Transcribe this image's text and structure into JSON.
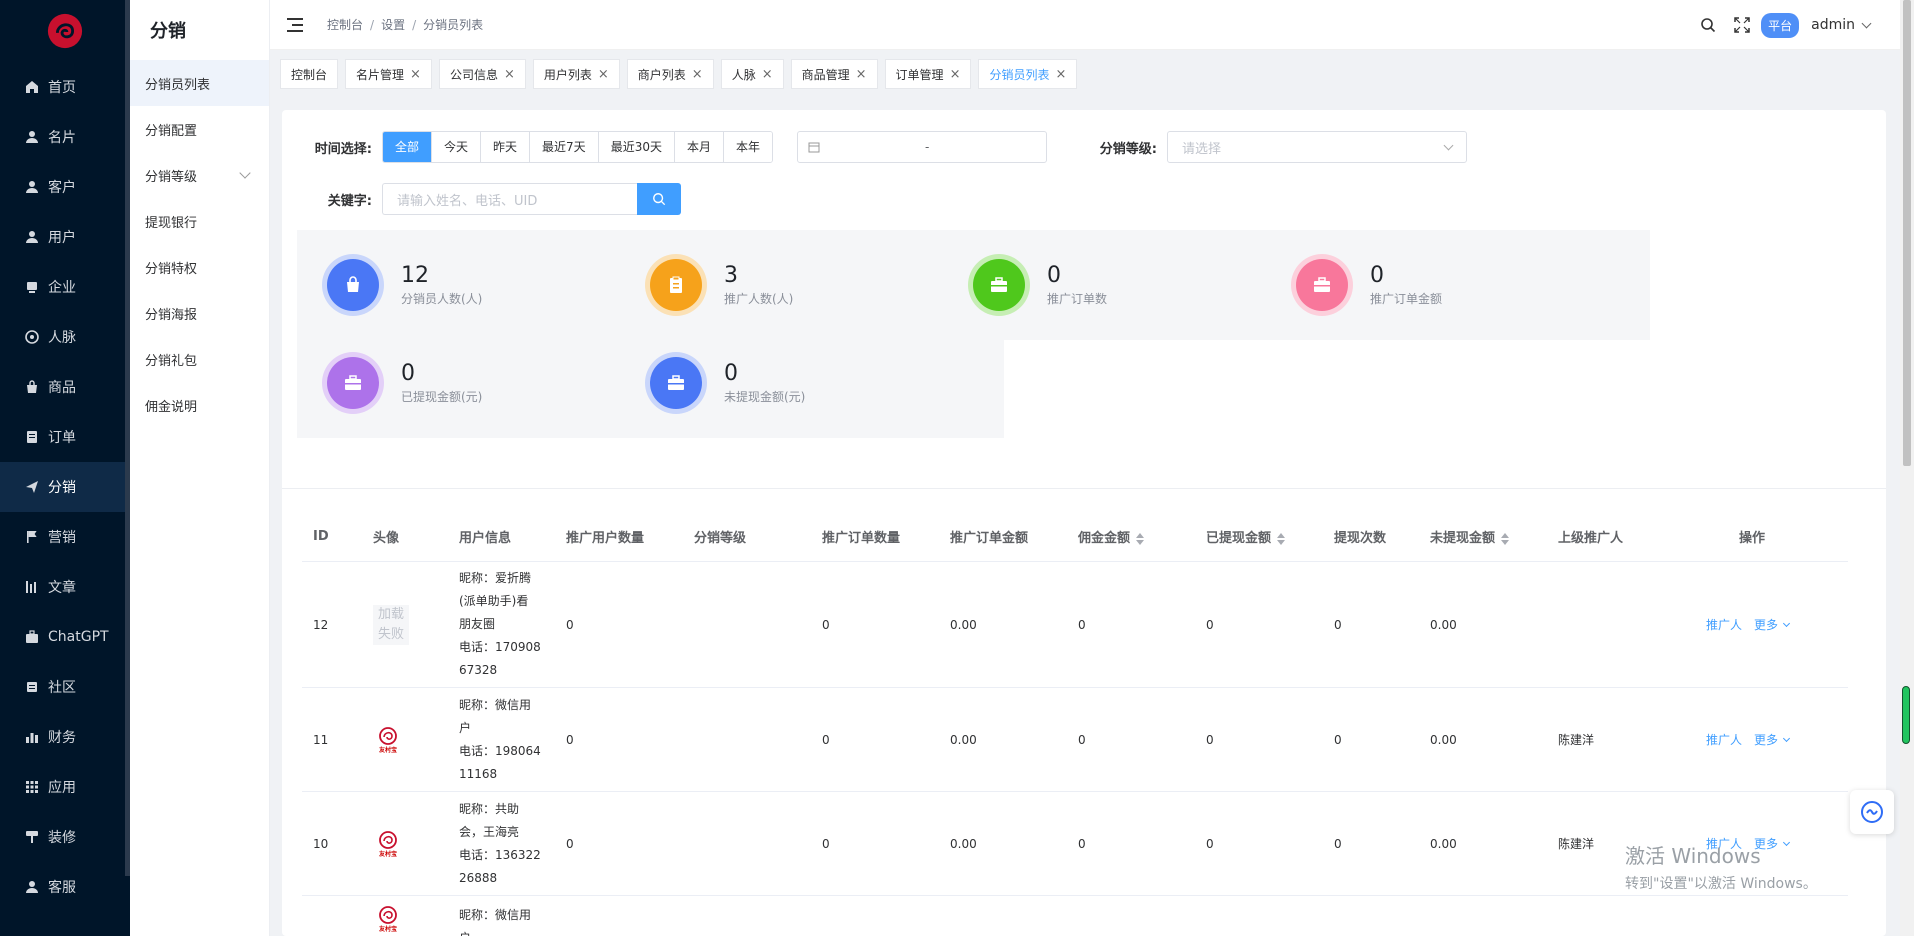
{
  "nav": {
    "items": [
      {
        "label": "首页",
        "icon": "home-icon"
      },
      {
        "label": "名片",
        "icon": "user-icon"
      },
      {
        "label": "客户",
        "icon": "user-icon"
      },
      {
        "label": "用户",
        "icon": "user-icon"
      },
      {
        "label": "企业",
        "icon": "building-icon"
      },
      {
        "label": "人脉",
        "icon": "network-icon"
      },
      {
        "label": "商品",
        "icon": "bag-icon"
      },
      {
        "label": "订单",
        "icon": "order-icon"
      },
      {
        "label": "分销",
        "icon": "send-icon"
      },
      {
        "label": "营销",
        "icon": "flag-icon"
      },
      {
        "label": "文章",
        "icon": "chart-icon"
      },
      {
        "label": "ChatGPT",
        "icon": "briefcase-icon"
      },
      {
        "label": "社区",
        "icon": "community-icon"
      },
      {
        "label": "财务",
        "icon": "bar-icon"
      },
      {
        "label": "应用",
        "icon": "grid-icon"
      },
      {
        "label": "装修",
        "icon": "brush-icon"
      },
      {
        "label": "客服",
        "icon": "user-icon"
      }
    ]
  },
  "submenu": {
    "title": "分销",
    "items": [
      "分销员列表",
      "分销配置",
      "分销等级",
      "提现银行",
      "分销特权",
      "分销海报",
      "分销礼包",
      "佣金说明"
    ]
  },
  "header": {
    "breadcrumb": [
      "控制台",
      "设置",
      "分销员列表"
    ],
    "platform_badge": "平台",
    "username": "admin"
  },
  "tags": [
    {
      "label": "控制台",
      "closable": false
    },
    {
      "label": "名片管理",
      "closable": true
    },
    {
      "label": "公司信息",
      "closable": true
    },
    {
      "label": "用户列表",
      "closable": true
    },
    {
      "label": "商户列表",
      "closable": true
    },
    {
      "label": "人脉",
      "closable": true
    },
    {
      "label": "商品管理",
      "closable": true
    },
    {
      "label": "订单管理",
      "closable": true
    },
    {
      "label": "分销员列表",
      "closable": true
    }
  ],
  "filters": {
    "time_label": "时间选择:",
    "time_options": [
      "全部",
      "今天",
      "昨天",
      "最近7天",
      "最近30天",
      "本月",
      "本年"
    ],
    "date_dash": "-",
    "level_label": "分销等级:",
    "level_placeholder": "请选择",
    "keyword_label": "关键字:",
    "keyword_placeholder": "请输入姓名、电话、UID"
  },
  "stats": [
    {
      "value": "12",
      "label": "分销员人数(人)",
      "color": "#4a77f5",
      "ring": "#c9d6fb"
    },
    {
      "value": "3",
      "label": "推广人数(人)",
      "color": "#f6a21b",
      "ring": "#fbe1b6"
    },
    {
      "value": "0",
      "label": "推广订单数",
      "color": "#4fc81c",
      "ring": "#c6eeb4"
    },
    {
      "value": "0",
      "label": "推广订单金额",
      "color": "#f8779b",
      "ring": "#fcd0dc"
    },
    {
      "value": "0",
      "label": "已提现金额(元)",
      "color": "#ad72ea",
      "ring": "#e3cff8"
    },
    {
      "value": "0",
      "label": "未提现金额(元)",
      "color": "#4a77f5",
      "ring": "#c9d6fb"
    }
  ],
  "table": {
    "headers": [
      "ID",
      "头像",
      "用户信息",
      "推广用户数量",
      "分销等级",
      "推广订单数量",
      "推广订单金额",
      "佣金金额",
      "已提现金额",
      "提现次数",
      "未提现金额",
      "上级推广人",
      "操作"
    ],
    "avatar_fail_text": "加载失败",
    "action_promoter": "推广人",
    "action_more": "更多",
    "rows": [
      {
        "id": "12",
        "avatar": "fail",
        "info": [
          "昵称：爱折腾",
          "(派单助手)看",
          "朋友圈",
          "电话：170908",
          "67328"
        ],
        "pu": "0",
        "lv": "",
        "po": "0",
        "pa": "0.00",
        "cm": "0",
        "wd": "0",
        "wc": "0",
        "uw": "0.00",
        "up": ""
      },
      {
        "id": "11",
        "avatar": "logo",
        "info": [
          "昵称：微信用",
          "户",
          "电话：198064",
          "11168"
        ],
        "pu": "0",
        "lv": "",
        "po": "0",
        "pa": "0.00",
        "cm": "0",
        "wd": "0",
        "wc": "0",
        "uw": "0.00",
        "up": "陈建洋"
      },
      {
        "id": "10",
        "avatar": "logo",
        "info": [
          "昵称：共助",
          "会，王海亮",
          "电话：136322",
          "26888"
        ],
        "pu": "0",
        "lv": "",
        "po": "0",
        "pa": "0.00",
        "cm": "0",
        "wd": "0",
        "wc": "0",
        "uw": "0.00",
        "up": "陈建洋"
      },
      {
        "id": "",
        "avatar": "logo",
        "info": [
          "昵称：微信用",
          "户"
        ],
        "pu": "",
        "lv": "",
        "po": "",
        "pa": "",
        "cm": "",
        "wd": "",
        "wc": "",
        "uw": "",
        "up": ""
      }
    ]
  },
  "watermark": {
    "line1": "激活 Windows",
    "line2": "转到\"设置\"以激活 Windows。"
  }
}
